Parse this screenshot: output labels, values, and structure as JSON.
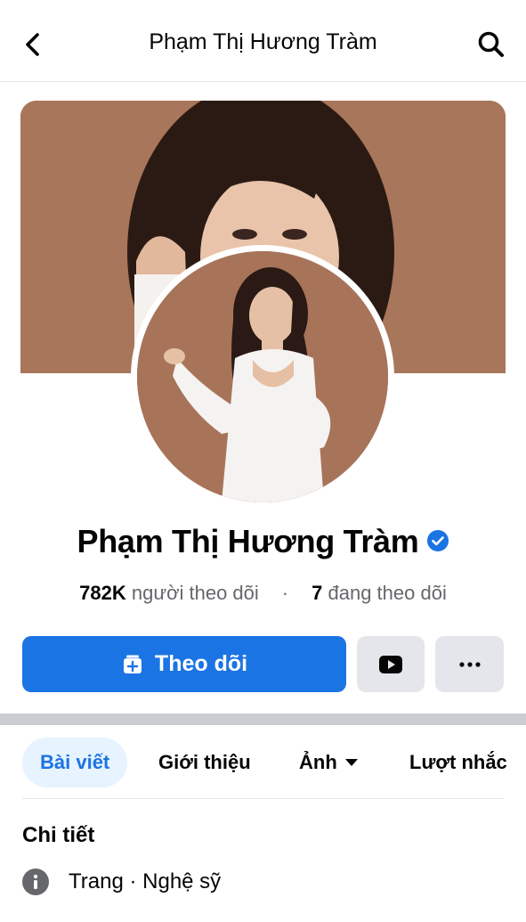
{
  "header": {
    "title": "Phạm Thị Hương Tràm",
    "back_icon": "chevron-left-icon",
    "search_icon": "search-icon"
  },
  "profile": {
    "name": "Phạm Thị Hương Tràm",
    "verified": true,
    "followers_count": "782K",
    "followers_label": "người theo dõi",
    "separator": "·",
    "following_count": "7",
    "following_label": "đang theo dõi"
  },
  "actions": {
    "follow_label": "Theo dõi",
    "follow_icon": "follow-plus-icon",
    "video_icon": "play-video-icon",
    "more_icon": "more-dots-icon"
  },
  "tabs": [
    {
      "label": "Bài viết",
      "active": true
    },
    {
      "label": "Giới thiệu",
      "active": false
    },
    {
      "label": "Ảnh",
      "active": false,
      "has_dropdown": true
    },
    {
      "label": "Lượt nhắc",
      "active": false
    }
  ],
  "details": {
    "title": "Chi tiết",
    "rows": [
      {
        "icon": "info-icon",
        "text": "Trang · Nghệ sỹ"
      }
    ]
  },
  "colors": {
    "brand_blue": "#1b74e4",
    "secondary_button": "#e4e6eb",
    "active_tab_bg": "#e7f3ff",
    "cover_background": "#a8765a"
  }
}
